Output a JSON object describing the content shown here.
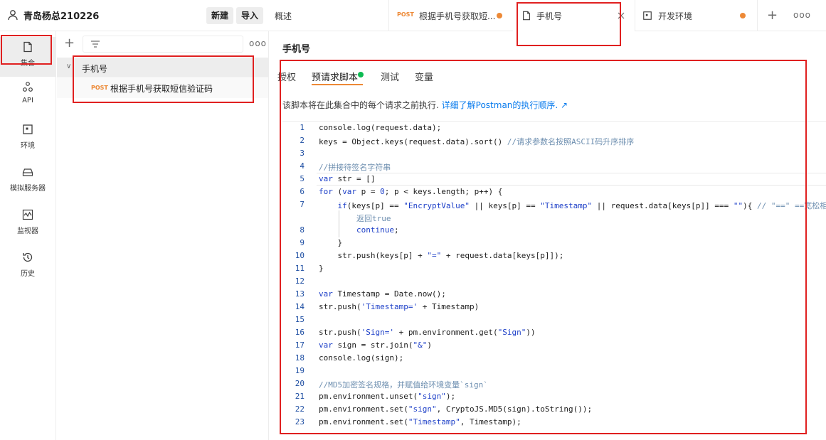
{
  "workspace": {
    "name": "青岛杨总210226",
    "new_label": "新建",
    "import_label": "导入"
  },
  "sidebar": {
    "items": [
      {
        "label": "集合",
        "icon": "collection-icon"
      },
      {
        "label": "API",
        "icon": "api-icon"
      },
      {
        "label": "环境",
        "icon": "environment-icon"
      },
      {
        "label": "模拟服务器",
        "icon": "mock-server-icon"
      },
      {
        "label": "监视器",
        "icon": "monitor-icon"
      },
      {
        "label": "历史",
        "icon": "history-icon"
      }
    ]
  },
  "tree": {
    "more": "ooo",
    "collection_name": "手机号",
    "request": {
      "method": "POST",
      "name": "根据手机号获取短信验证码"
    }
  },
  "tabs": {
    "overview": "概述",
    "post_method": "POST",
    "post_name": "根据手机号获取短...",
    "phone": "手机号",
    "env": "开发环境",
    "more": "ooo"
  },
  "main": {
    "title": "手机号",
    "subtabs": [
      "授权",
      "预请求脚本",
      "测试",
      "变量"
    ],
    "description": "该脚本将在此集合中的每个请求之前执行.",
    "description_link": "详细了解Postman的执行顺序. ↗"
  },
  "code": {
    "line_numbers": [
      "1",
      "2",
      "3",
      "4",
      "5",
      "6",
      "7",
      "",
      "8",
      "9",
      "10",
      "11",
      "12",
      "13",
      "14",
      "15",
      "16",
      "17",
      "18",
      "19",
      "20",
      "21",
      "22",
      "23"
    ]
  },
  "colors": {
    "accent_orange": "#ed8936",
    "dot_green": "#0cbb52",
    "link_blue": "#097bed",
    "annotation_red": "#e02020"
  }
}
